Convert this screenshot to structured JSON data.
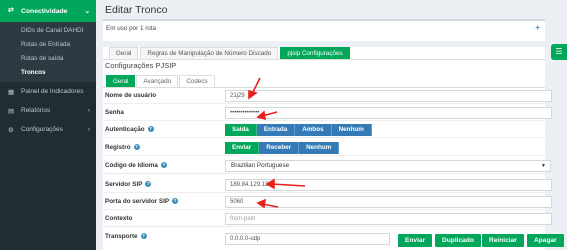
{
  "sidebar": {
    "section": "Conectividade",
    "subitems": [
      "DIDs de Canal DAHDI",
      "Rotas de Entrada",
      "Rotas de saída",
      "Troncos"
    ],
    "items": [
      {
        "label": "Painel de Indicadores"
      },
      {
        "label": "Relatórios"
      },
      {
        "label": "Configurações"
      }
    ]
  },
  "page": {
    "title": "Editar Tronco",
    "usage": "Em uso por 1 rota"
  },
  "tabs": [
    "Geral",
    "Regras de Manipulação de Número Discado",
    "pjsip Configurações"
  ],
  "panel_title": "Configurações PJSIP",
  "subtabs": [
    "Geral",
    "Avançado",
    "Codecs"
  ],
  "fields": {
    "username_label": "Nome de usuário",
    "username_value": "21j29",
    "password_label": "Senha",
    "password_value": "••••••••••••••",
    "auth_label": "Autenticação",
    "auth_options": [
      "Saída",
      "Entrada",
      "Ambos",
      "Nenhum"
    ],
    "register_label": "Registro",
    "register_options": [
      "Enviar",
      "Receber",
      "Nenhum"
    ],
    "lang_label": "Código de Idioma",
    "lang_value": "Brazilian Portuguese",
    "server_label": "Servidor SIP",
    "server_value": "189.84.129.12",
    "port_label": "Porta do servidor SIP",
    "port_value": "5060",
    "context_label": "Contexto",
    "context_value": "from-pstn",
    "transport_label": "Transporte",
    "transport_value": "0.0.0.0-udp"
  },
  "actions": [
    "Enviar",
    "Duplicado",
    "Reiniciar",
    "Apagar"
  ],
  "colors": {
    "green": "#00a65a",
    "blue": "#337ab7",
    "sidebar": "#222d32",
    "arrow": "#e8201d"
  }
}
